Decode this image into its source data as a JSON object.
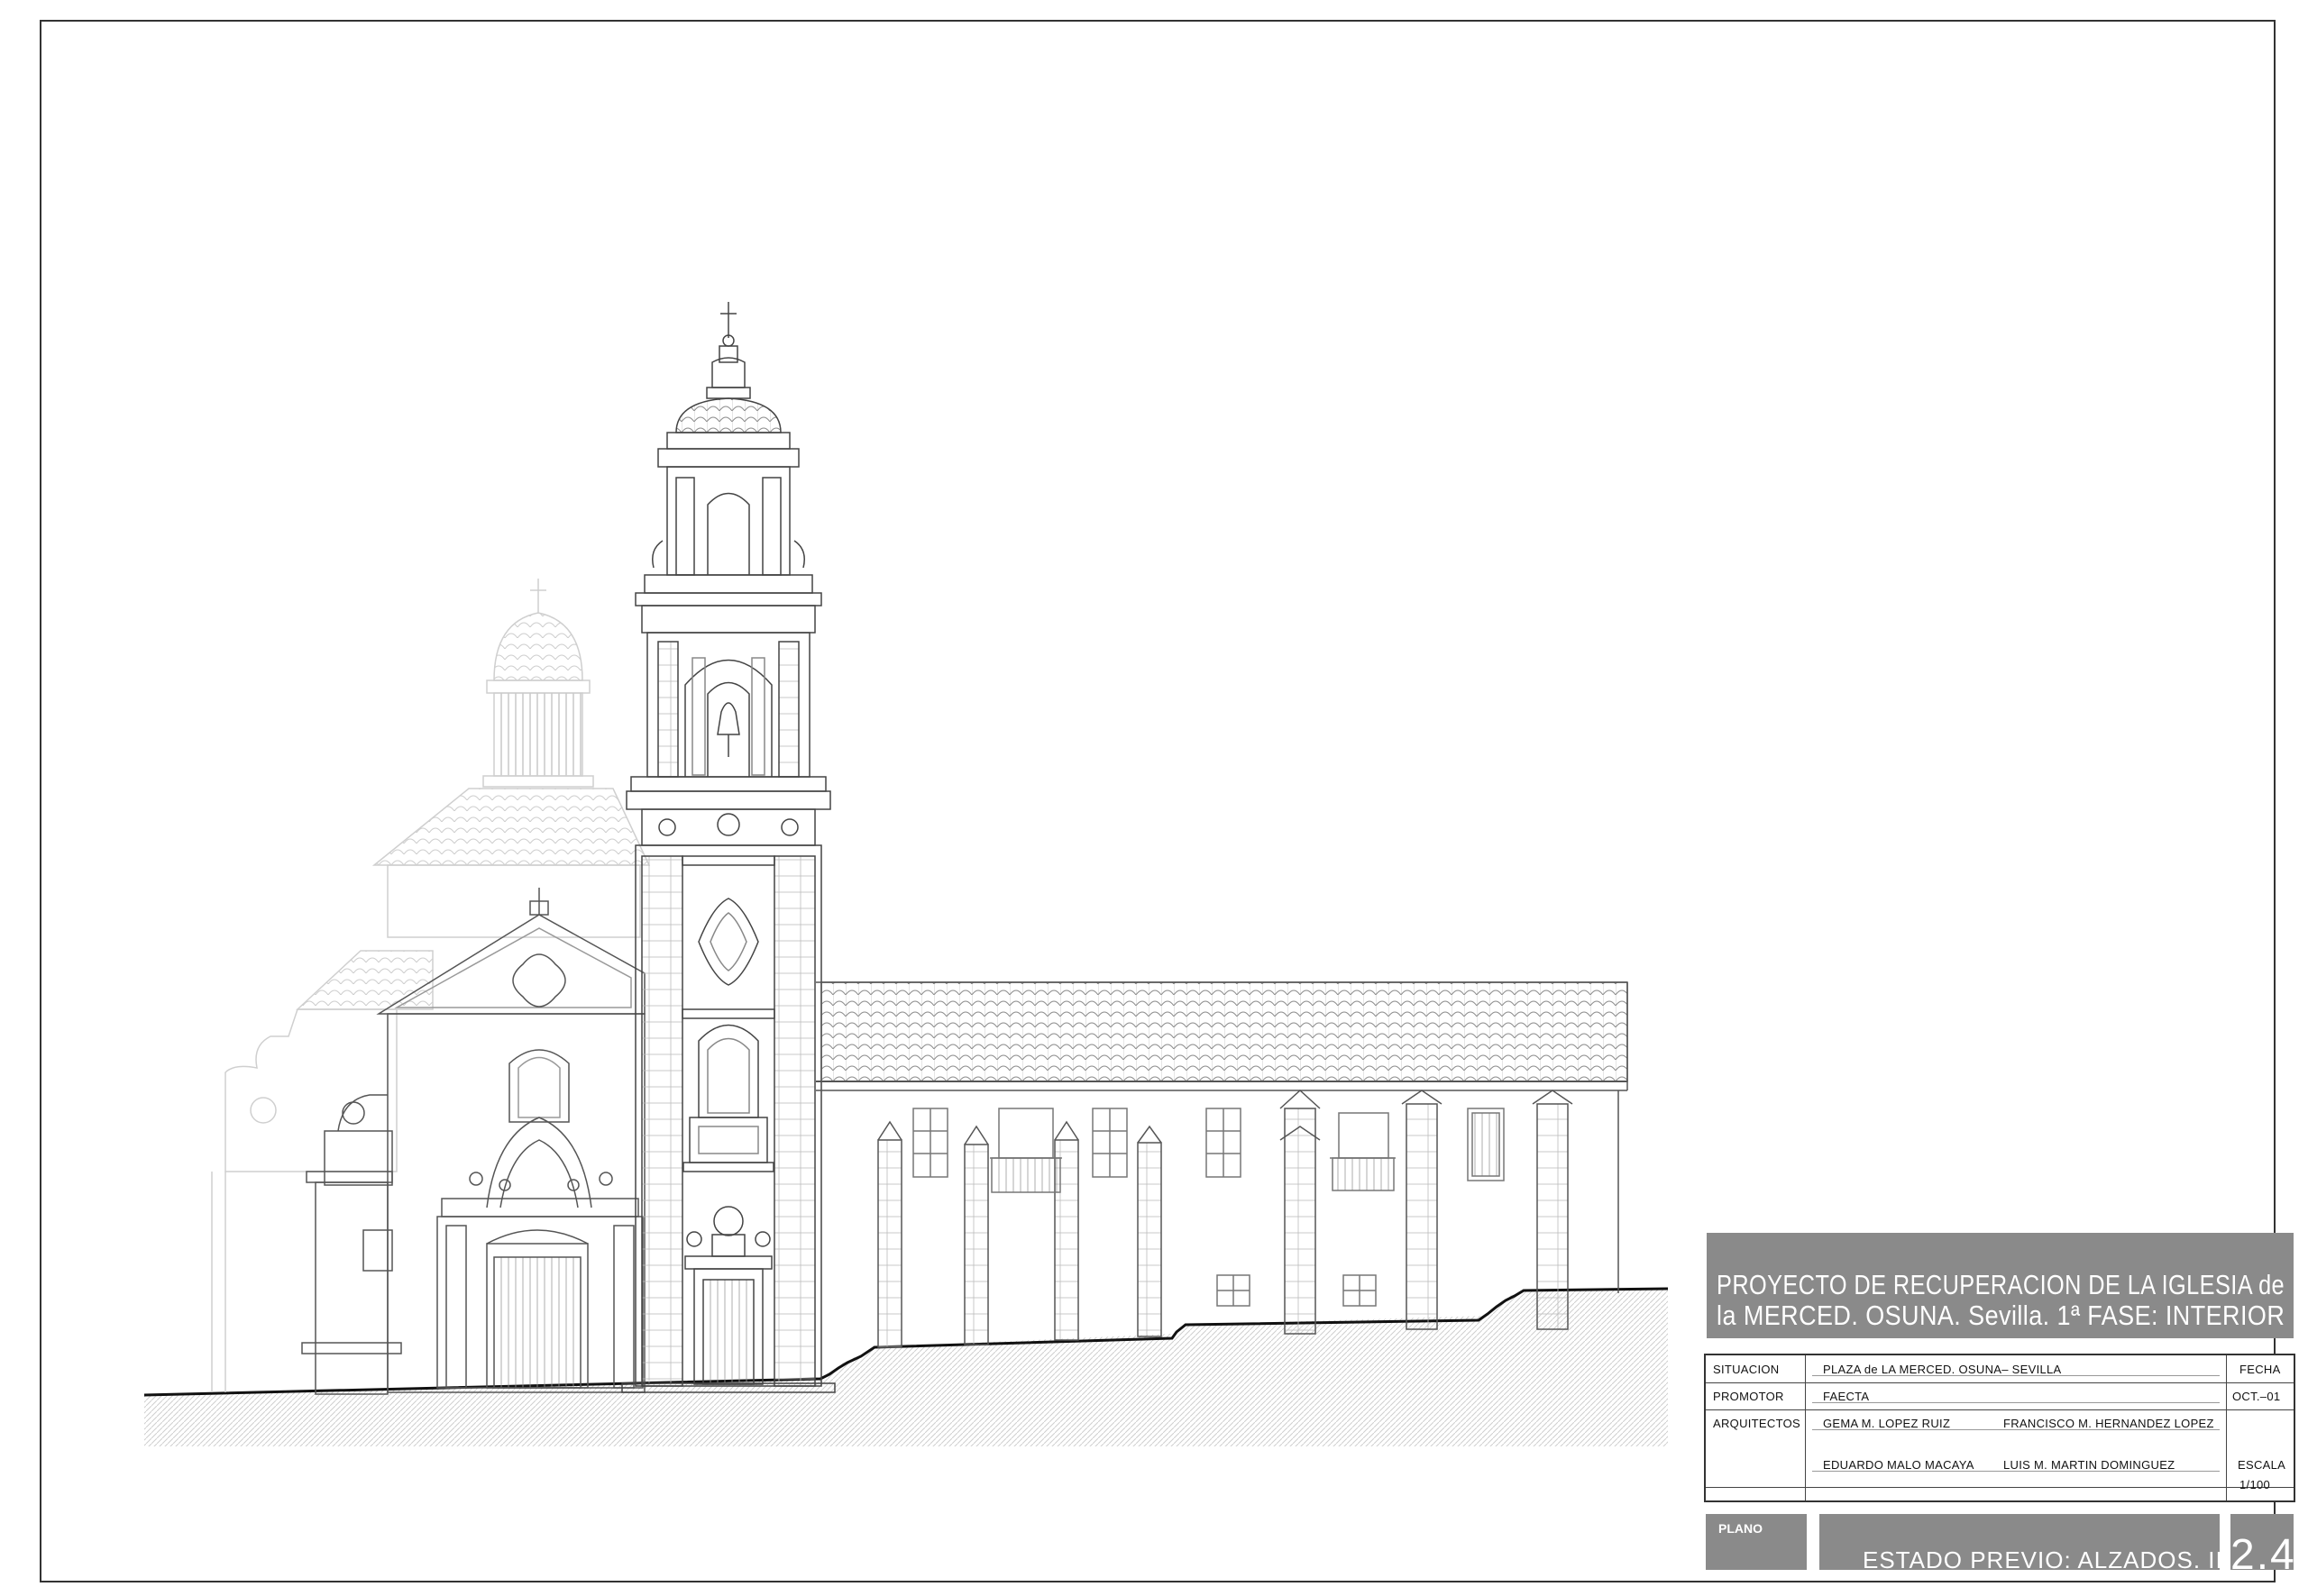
{
  "title_block": {
    "line1": "PROYECTO DE RECUPERACION DE LA IGLESIA de",
    "line2": "la MERCED. OSUNA.  Sevilla.   1ª FASE: INTERIOR"
  },
  "info": {
    "situacion_label": "SITUACION",
    "situacion_value": "PLAZA de LA MERCED. OSUNA– SEVILLA",
    "promotor_label": "PROMOTOR",
    "promotor_value": "FAECTA",
    "arquitectos_label": "ARQUITECTOS",
    "arquitecto_1": "GEMA M. LOPEZ RUIZ",
    "arquitecto_2": "FRANCISCO M. HERNANDEZ LOPEZ",
    "arquitecto_3": "EDUARDO MALO MACAYA",
    "arquitecto_4": "LUIS M. MARTIN DOMINGUEZ",
    "fecha_label": "FECHA",
    "fecha_value": "OCT.–01",
    "escala_label": "ESCALA",
    "escala_value": "1/100"
  },
  "plano": {
    "label": "PLANO",
    "name": "ESTADO PREVIO: ALZADOS. II",
    "number": "2.4"
  },
  "colors": {
    "line": "#4a4a4a",
    "faint_line": "#c8c8c8",
    "title_fill": "#8a8a8a",
    "ground_hatch": "#dcdcdc"
  }
}
